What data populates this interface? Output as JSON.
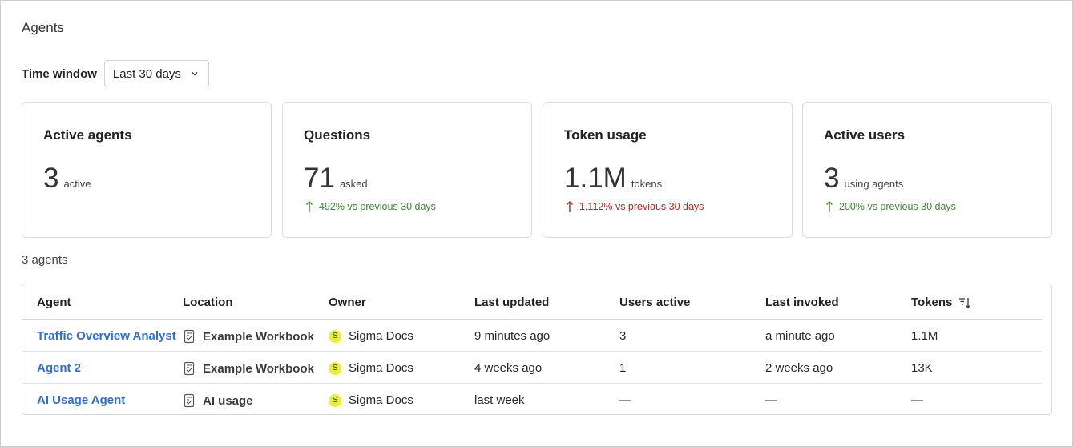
{
  "page": {
    "title": "Agents"
  },
  "filter": {
    "label": "Time window",
    "value": "Last 30 days"
  },
  "cards": [
    {
      "title": "Active agents",
      "value": "3",
      "unit": "active",
      "delta": "",
      "trend": ""
    },
    {
      "title": "Questions",
      "value": "71",
      "unit": "asked",
      "delta": "492% vs previous 30 days",
      "trend": "up-green"
    },
    {
      "title": "Token usage",
      "value": "1.1M",
      "unit": "tokens",
      "delta": "1,112% vs previous 30 days",
      "trend": "up-red"
    },
    {
      "title": "Active users",
      "value": "3",
      "unit": "using agents",
      "delta": "200% vs previous 30 days",
      "trend": "up-green"
    }
  ],
  "agents_count": "3 agents",
  "table": {
    "columns": [
      "Agent",
      "Location",
      "Owner",
      "Last updated",
      "Users active",
      "Last invoked",
      "Tokens"
    ],
    "rows": [
      {
        "agent": "Traffic Overview Analyst",
        "location": "Example Workbook",
        "owner_initial": "S",
        "owner": "Sigma Docs",
        "last_updated": "9 minutes ago",
        "users_active": "3",
        "last_invoked": "a minute ago",
        "tokens": "1.1M"
      },
      {
        "agent": "Agent 2",
        "location": "Example Workbook",
        "owner_initial": "S",
        "owner": "Sigma Docs",
        "last_updated": "4 weeks ago",
        "users_active": "1",
        "last_invoked": "2 weeks ago",
        "tokens": "13K"
      },
      {
        "agent": "AI Usage Agent",
        "location": "AI usage",
        "owner_initial": "S",
        "owner": "Sigma Docs",
        "last_updated": "last week",
        "users_active": "—",
        "last_invoked": "—",
        "tokens": "—"
      }
    ]
  },
  "colors": {
    "link": "#2e6fd0",
    "positive": "#3d8a2f",
    "negative": "#b3261e",
    "avatar": "#e6f03c"
  },
  "icons": {
    "select": "chevron-down-icon",
    "trend": "arrow-up-icon",
    "location": "workbook-icon",
    "sort": "sort-descending-icon"
  }
}
